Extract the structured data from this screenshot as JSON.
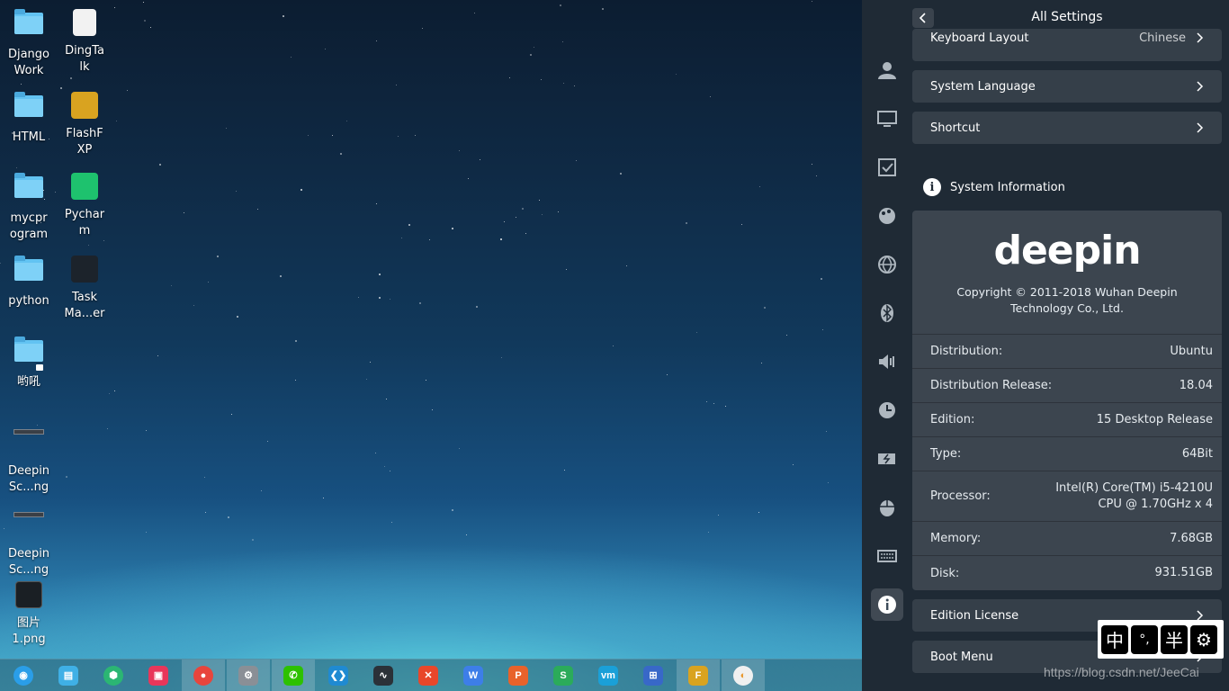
{
  "desktop": {
    "icons": [
      {
        "label": "Django\nWork",
        "type": "folder"
      },
      {
        "label": "DingTa\nlk",
        "type": "doc"
      },
      {
        "label": "HTML",
        "type": "folder"
      },
      {
        "label": "FlashF\nXP",
        "type": "app"
      },
      {
        "label": "mycpr\nogram",
        "type": "folder"
      },
      {
        "label": "Pychar\nm",
        "type": "app"
      },
      {
        "label": "python",
        "type": "folder"
      },
      {
        "label": "Task\nMa...er",
        "type": "app"
      },
      {
        "label": "哟吼",
        "type": "folder-locked"
      },
      {
        "label": "Deepin\nSc...ng",
        "type": "screenshot"
      },
      {
        "label": "Deepin\nSc...ng",
        "type": "screenshot"
      },
      {
        "label": "图片\n1.png",
        "type": "image"
      }
    ]
  },
  "taskbar": {
    "items": [
      {
        "name": "launcher-icon",
        "color": "#2a9ee8",
        "glyph": "◉"
      },
      {
        "name": "file-manager-icon",
        "color": "#3fb0e6",
        "glyph": "▤"
      },
      {
        "name": "store-icon",
        "color": "#2bb673",
        "glyph": "⬢"
      },
      {
        "name": "screenshot-tool-icon",
        "color": "#e8365a",
        "glyph": "▣"
      },
      {
        "name": "chrome-icon",
        "color": "#e8453c",
        "glyph": "●",
        "active": true
      },
      {
        "name": "settings-icon",
        "color": "#8a8f96",
        "glyph": "⚙",
        "active": true
      },
      {
        "name": "wechat-icon",
        "color": "#2dc100",
        "glyph": "✆",
        "active": true
      },
      {
        "name": "vscode-icon",
        "color": "#1f8ad2",
        "glyph": "❮❯"
      },
      {
        "name": "system-monitor-icon",
        "color": "#2b3138",
        "glyph": "∿"
      },
      {
        "name": "xmind-icon",
        "color": "#e8472a",
        "glyph": "✕"
      },
      {
        "name": "wps-writer-icon",
        "color": "#3d7ee8",
        "glyph": "W"
      },
      {
        "name": "wps-presentation-icon",
        "color": "#e8622a",
        "glyph": "P"
      },
      {
        "name": "wps-spreadsheet-icon",
        "color": "#2bab5a",
        "glyph": "S"
      },
      {
        "name": "vmware-icon",
        "color": "#1aa0d8",
        "glyph": "vm"
      },
      {
        "name": "network-icon",
        "color": "#3868c8",
        "glyph": "⊞"
      },
      {
        "name": "flashfxp-icon",
        "color": "#d9a320",
        "glyph": "F",
        "active": true
      },
      {
        "name": "browser-icon",
        "color": "#f0f0f0",
        "glyph": "◐",
        "active": true
      }
    ]
  },
  "settings": {
    "title": "All Settings",
    "rows_top": [
      {
        "label": "Keyboard Layout",
        "value": "Chinese"
      },
      {
        "label": "System Language",
        "value": ""
      },
      {
        "label": "Shortcut",
        "value": ""
      }
    ],
    "section_title": "System Information",
    "logo_text": "deepin",
    "copyright": "Copyright © 2011-2018 Wuhan Deepin Technology Co., Ltd.",
    "info": [
      {
        "key": "Distribution:",
        "value": "Ubuntu"
      },
      {
        "key": "Distribution Release:",
        "value": "18.04"
      },
      {
        "key": "Edition:",
        "value": "15 Desktop Release"
      },
      {
        "key": "Type:",
        "value": "64Bit"
      },
      {
        "key": "Processor:",
        "value": "Intel(R) Core(TM) i5-4210U\nCPU @ 1.70GHz x 4"
      },
      {
        "key": "Memory:",
        "value": "7.68GB"
      },
      {
        "key": "Disk:",
        "value": "931.51GB"
      }
    ],
    "rows_bottom": [
      {
        "label": "Edition License"
      },
      {
        "label": "Boot Menu"
      }
    ],
    "rail_icons": [
      "account-icon",
      "display-icon",
      "default-apps-icon",
      "personalization-icon",
      "network-icon",
      "bluetooth-icon",
      "sound-icon",
      "time-icon",
      "power-icon",
      "mouse-icon",
      "keyboard-icon",
      "system-info-icon"
    ]
  },
  "ime": {
    "buttons": [
      "中",
      "°,",
      "半",
      "⚙"
    ]
  },
  "watermark": "https://blog.csdn.net/JeeCai"
}
